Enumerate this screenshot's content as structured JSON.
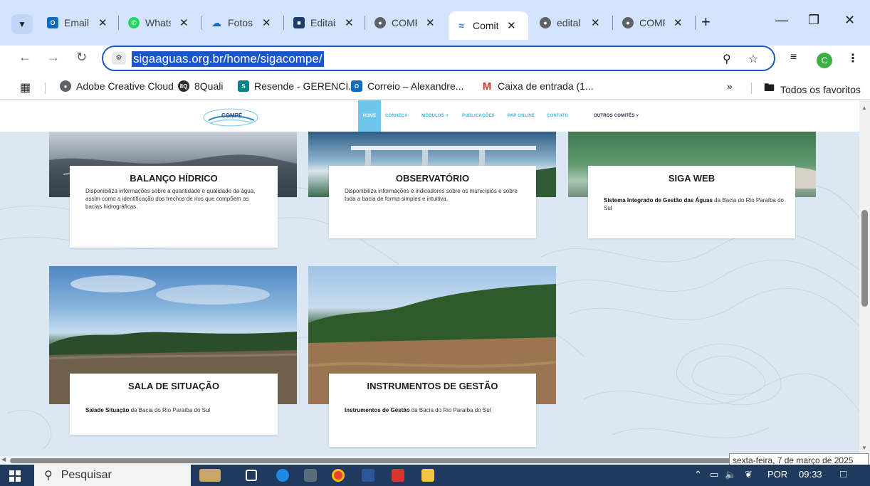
{
  "browser": {
    "tabs": [
      {
        "label": "Email",
        "favicon": "outlook",
        "color": "#0f6cbd"
      },
      {
        "label": "Whats",
        "favicon": "whatsapp",
        "color": "#25d366"
      },
      {
        "label": "Fotos",
        "favicon": "cloud",
        "color": "#0f6cbd"
      },
      {
        "label": "Editais",
        "favicon": "page",
        "color": "#1a3d6d"
      },
      {
        "label": "COMP",
        "favicon": "globe",
        "color": "#5f6368"
      },
      {
        "label": "Comit",
        "favicon": "water",
        "color": "#2a7de1",
        "active": true
      },
      {
        "label": "edital",
        "favicon": "globe",
        "color": "#5f6368"
      },
      {
        "label": "COMP",
        "favicon": "globe",
        "color": "#5f6368"
      }
    ],
    "url": "sigaaguas.org.br/home/sigacompe/",
    "profile_initial": "C",
    "bookmarks": [
      {
        "label": "Adobe Creative Cloud",
        "icon": "globe-icon",
        "color": "#5f6368"
      },
      {
        "label": "8Quali",
        "icon": "8q",
        "color": "#2b2b2b"
      },
      {
        "label": "Resende - GERENCI...",
        "icon": "sharepoint",
        "color": "#038387"
      },
      {
        "label": "Correio – Alexandre...",
        "icon": "outlook",
        "color": "#0f6cbd"
      },
      {
        "label": "Caixa de entrada (1...",
        "icon": "gmail",
        "color": "#d93025"
      }
    ],
    "bookmarks_overflow": "»",
    "all_bookmarks": "Todos os favoritos"
  },
  "site": {
    "logo_text": "COMPÉ",
    "nav": {
      "home": "HOME",
      "conheca": "CONHEÇA",
      "modulos": "MÓDULOS ˅",
      "publicacoes": "PUBLICAÇÕES",
      "pap": "PAP ONLINE",
      "contato": "CONTATO",
      "outros": "OUTROS COMITÊS ˅"
    },
    "cards": [
      {
        "title": "BALANÇO HÍDRICO",
        "desc_bold": "",
        "desc": "Disponibiliza informações sobre a quantidade e qualidade da água, assim como a identificação dos trechos de rios que compõem as bacias hidrográficas."
      },
      {
        "title": "OBSERVATÓRIO",
        "desc_bold": "",
        "desc": "Disponibiliza informações e indicadores sobre os municípios e sobre toda a bacia de forma simples e intuitiva."
      },
      {
        "title": "SIGA WEB",
        "desc_bold": "Sistema Integrado de Gestão das Águas",
        "desc": " da Bacia do Rio Paraíba do Sul"
      },
      {
        "title": "SALA DE SITUAÇÃO",
        "desc_bold": "Salade Situação",
        "desc": " da Bacia do Rio Paraíba do Sul"
      },
      {
        "title": "INSTRUMENTOS DE GESTÃO",
        "desc_bold": "Instrumentos de Gestão",
        "desc": " da Bacia do Rio Paraíba do Sul"
      }
    ]
  },
  "tooltip": "sexta-feira, 7 de março de 2025",
  "taskbar": {
    "search_placeholder": "Pesquisar",
    "language": "POR",
    "time": "09:33"
  }
}
